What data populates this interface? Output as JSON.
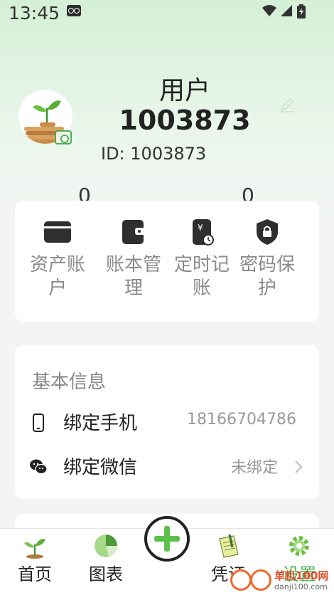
{
  "status_bar": {
    "time": "13:45"
  },
  "profile": {
    "username_label": "用户",
    "username": "1003873",
    "id_text": "ID: 1003873",
    "stat_left": "0",
    "stat_right": "0"
  },
  "actions": [
    {
      "label": "资产账户",
      "icon": "card-icon"
    },
    {
      "label": "账本管理",
      "icon": "wallet-icon"
    },
    {
      "label": "定时记账",
      "icon": "scheduled-bill-icon"
    },
    {
      "label": "密码保护",
      "icon": "shield-lock-icon"
    }
  ],
  "basic_info": {
    "title": "基本信息",
    "phone": {
      "label": "绑定手机",
      "value": "18166704786",
      "icon": "phone-icon"
    },
    "wechat": {
      "label": "绑定微信",
      "value": "未绑定",
      "icon": "wechat-icon"
    }
  },
  "tabs": [
    {
      "label": "首页",
      "icon": "sprout-icon"
    },
    {
      "label": "图表",
      "icon": "pie-chart-icon"
    },
    {
      "label": "凭证",
      "icon": "notepad-icon"
    },
    {
      "label": "设置",
      "icon": "gear-icon"
    }
  ],
  "active_tab": "设置",
  "watermark": {
    "name": "单机100网",
    "url": "danji100.com"
  },
  "colors": {
    "accent": "#4caf50",
    "header_gradient_top": "#d4f0d6",
    "card": "#ffffff",
    "background": "#f4f4f4"
  }
}
